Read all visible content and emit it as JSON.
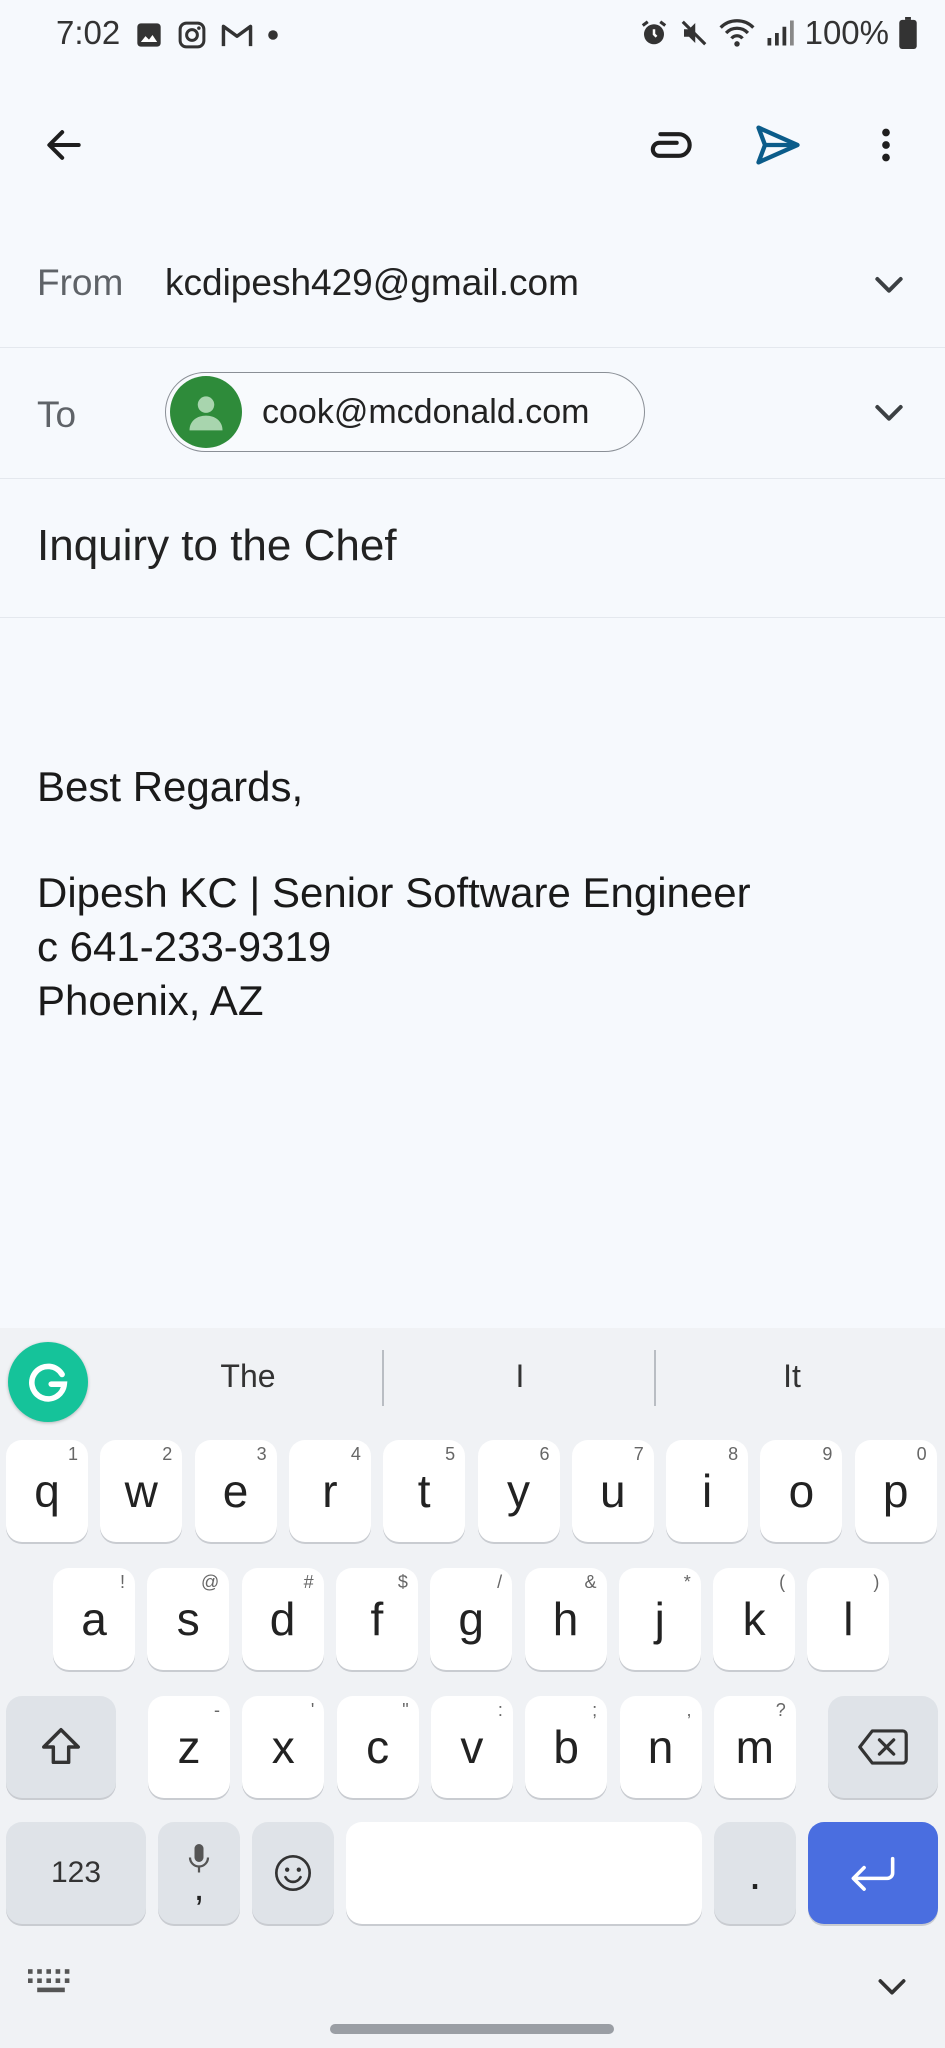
{
  "status_bar": {
    "time": "7:02",
    "battery": "100%",
    "icons_left": [
      "gallery-icon",
      "instagram-icon",
      "gmail-icon",
      "dot-icon"
    ],
    "icons_right": [
      "alarm-icon",
      "mute-icon",
      "wifi-icon",
      "signal-icon",
      "battery-icon"
    ]
  },
  "app_bar": {
    "actions": [
      "back-arrow-icon",
      "attach-icon",
      "send-icon",
      "more-vert-icon"
    ],
    "send_color": "#0b5c8a"
  },
  "compose": {
    "from_label": "From",
    "from_value": "kcdipesh429@gmail.com",
    "to_label": "To",
    "to_chip": "cook@mcdonald.com",
    "subject": "Inquiry to the Chef",
    "body_lines": [
      "Best Regards,",
      "",
      "Dipesh KC | Senior Software Engineer",
      "c 641-233-9319",
      "Phoenix, AZ"
    ]
  },
  "keyboard": {
    "suggestions": [
      "The",
      "I",
      "It"
    ],
    "row1": [
      {
        "k": "q",
        "h": "1"
      },
      {
        "k": "w",
        "h": "2"
      },
      {
        "k": "e",
        "h": "3"
      },
      {
        "k": "r",
        "h": "4"
      },
      {
        "k": "t",
        "h": "5"
      },
      {
        "k": "y",
        "h": "6"
      },
      {
        "k": "u",
        "h": "7"
      },
      {
        "k": "i",
        "h": "8"
      },
      {
        "k": "o",
        "h": "9"
      },
      {
        "k": "p",
        "h": "0"
      }
    ],
    "row2": [
      {
        "k": "a",
        "h": "!"
      },
      {
        "k": "s",
        "h": "@"
      },
      {
        "k": "d",
        "h": "#"
      },
      {
        "k": "f",
        "h": "$"
      },
      {
        "k": "g",
        "h": "/"
      },
      {
        "k": "h",
        "h": "&"
      },
      {
        "k": "j",
        "h": "*"
      },
      {
        "k": "k",
        "h": "("
      },
      {
        "k": "l",
        "h": ")"
      }
    ],
    "row3": [
      {
        "k": "z",
        "h": "-"
      },
      {
        "k": "x",
        "h": "'"
      },
      {
        "k": "c",
        "h": "\""
      },
      {
        "k": "v",
        "h": ":"
      },
      {
        "k": "b",
        "h": ";"
      },
      {
        "k": "n",
        "h": ","
      },
      {
        "k": "m",
        "h": "?"
      }
    ],
    "numbers_key": "123",
    "mic_comma": ",",
    "period": ".",
    "accent": "#4a6ee0",
    "grammarly_color": "#15c39a"
  }
}
